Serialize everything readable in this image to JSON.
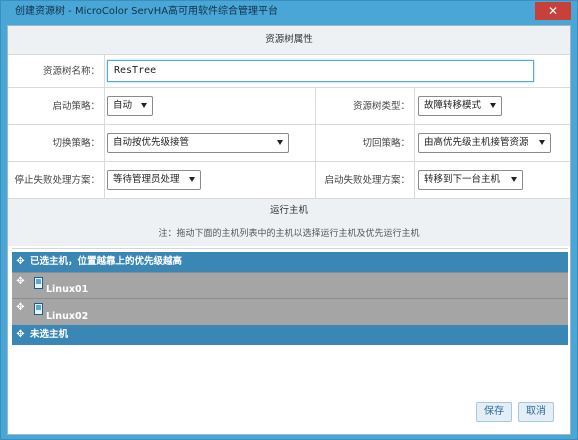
{
  "window": {
    "title": "创建资源树 - MicroColor ServHA高可用软件综合管理平台",
    "close_glyph": "✕"
  },
  "attributes_section": {
    "title": "资源树属性"
  },
  "form": {
    "name_label": "资源树名称：",
    "name_value": "ResTree",
    "start_policy_label": "启动策略：",
    "start_policy_value": "自动",
    "tree_type_label": "资源树类型：",
    "tree_type_value": "故障转移模式",
    "switch_policy_label": "切换策略：",
    "switch_policy_value": "自动按优先级接管",
    "switchback_policy_label": "切回策略：",
    "switchback_policy_value": "由高优先级主机接管资源",
    "stop_failure_label": "停止失败处理方案：",
    "stop_failure_value": "等待管理员处理",
    "start_failure_label": "启动失败处理方案：",
    "start_failure_value": "转移到下一台主机"
  },
  "hosts_section": {
    "title": "运行主机",
    "note": "注：拖动下面的主机列表中的主机以选择运行主机及优先运行主机",
    "selected_header": "已选主机，位置越靠上的优先级越高",
    "hosts": [
      "Linux01",
      "Linux02"
    ],
    "unselected_header": "未选主机"
  },
  "buttons": {
    "save": "保存",
    "cancel": "取消"
  },
  "colors": {
    "accent": "#3a86b4",
    "titlebar": "#4aa6d6",
    "close": "#c7413a",
    "gray_row": "#a5a5a5"
  }
}
